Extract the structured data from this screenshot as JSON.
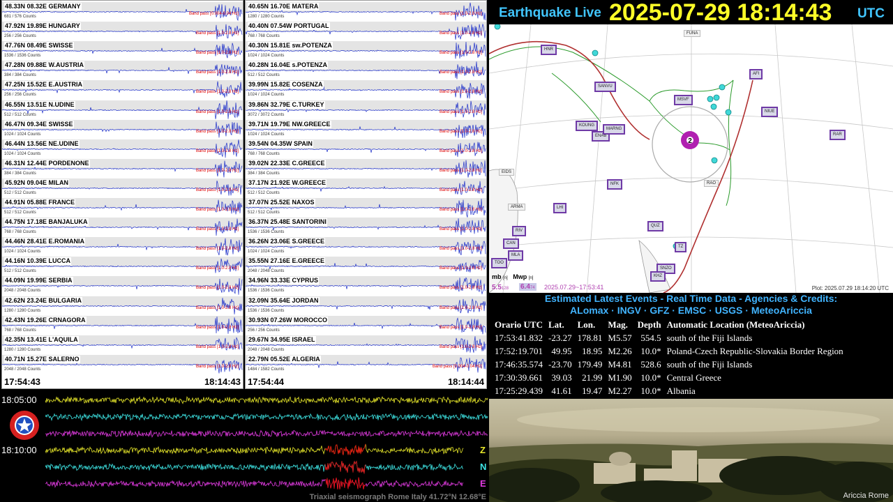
{
  "header": {
    "title": "Earthquake Live",
    "clock": "2025-07-29 18:14:43",
    "tz": "UTC"
  },
  "panels": [
    {
      "start_time": "17:54:43",
      "end_time": "18:14:43",
      "stations": [
        {
          "label": "48.33N 08.32E GERMANY",
          "counts": "681 / 576 Counts",
          "band": "Band pass [0.004-0.04 Hz]"
        },
        {
          "label": "47.92N 19.89E HUNGARY",
          "counts": "256 / 256 Counts",
          "band": "Band pass [1.0-2.8 Hz]"
        },
        {
          "label": "47.76N 08.49E SWISSE",
          "counts": "1536 / 1536 Counts",
          "band": "Band pass [1.0-2.8 Hz]"
        },
        {
          "label": "47.28N 09.88E W.AUSTRIA",
          "counts": "384 / 384 Counts",
          "band": "Band pass [1.0-2.8 Hz]"
        },
        {
          "label": "47.25N 15.52E E.AUSTRIA",
          "counts": "256 / 256 Counts",
          "band": "Band pass [1.0-2.8 Hz]"
        },
        {
          "label": "46.55N 13.51E N.UDINE",
          "counts": "512 / 512 Counts",
          "band": "Band pass [1.0-2.8 Hz]"
        },
        {
          "label": "46.47N 09.34E SWISSE",
          "counts": "1024 / 1024 Counts",
          "band": "Band pass [1.0-2.8 Hz]"
        },
        {
          "label": "46.44N 13.56E NE.UDINE",
          "counts": "1024 / 1024 Counts",
          "band": "Band pass [1.0-2.8 Hz]"
        },
        {
          "label": "46.31N 12.44E PORDENONE",
          "counts": "384 / 384 Counts",
          "band": "Band pass [1.0-2.8 Hz]"
        },
        {
          "label": "45.92N 09.04E MILAN",
          "counts": "512 / 512 Counts",
          "band": "Band pass [1.0-2.8 Hz]"
        },
        {
          "label": "44.91N 05.88E FRANCE",
          "counts": "512 / 512 Counts",
          "band": "Band pass [1.0-2.8 Hz]"
        },
        {
          "label": "44.75N 17.18E BANJALUKA",
          "counts": "768 / 768 Counts",
          "band": "Band pass [1.0-2.8 Hz]"
        },
        {
          "label": "44.46N 28.41E E.ROMANIA",
          "counts": "1024 / 1024 Counts",
          "band": "Band pass [1.0-2.8 Hz]"
        },
        {
          "label": "44.16N 10.39E LUCCA",
          "counts": "512 / 512 Counts",
          "band": "Band pass [1.0-2.8 Hz]"
        },
        {
          "label": "44.09N 19.99E SERBIA",
          "counts": "2048 / 2048 Counts",
          "band": "Band pass [1.0-2.8 Hz]"
        },
        {
          "label": "42.62N 23.24E BULGARIA",
          "counts": "1280 / 1280 Counts",
          "band": "Band pass [1.0-2.8 Hz]"
        },
        {
          "label": "42.43N 19.26E CRNAGORA",
          "counts": "768 / 768 Counts",
          "band": "Band pass [1.0-2.8 Hz]"
        },
        {
          "label": "42.35N 13.41E L'AQUILA",
          "counts": "1280 / 1280 Counts",
          "band": "Band pass [1.0-2.8 Hz]"
        },
        {
          "label": "40.71N 15.27E SALERNO",
          "counts": "2048 / 2048 Counts",
          "band": "Band pass [1.0-2.8 Hz]"
        }
      ]
    },
    {
      "start_time": "17:54:44",
      "end_time": "18:14:44",
      "stations": [
        {
          "label": "40.65N 16.70E MATERA",
          "counts": "1280 / 1280 Counts",
          "band": "Band pass [1.0-2.8 Hz]"
        },
        {
          "label": "40.40N 07.54W PORTUGAL",
          "counts": "768 / 768 Counts",
          "band": "Band pass [1.0-2.8 Hz]"
        },
        {
          "label": "40.30N 15.81E sw.POTENZA",
          "counts": "1024 / 1024 Counts",
          "band": "Band pass [1.0-2.8 Hz]"
        },
        {
          "label": "40.28N 16.04E s.POTENZA",
          "counts": "512 / 512 Counts",
          "band": "Band pass [1.0-2.8 Hz]"
        },
        {
          "label": "39.99N 15.82E COSENZA",
          "counts": "1024 / 1024 Counts",
          "band": "Band pass [1.0-2.8 Hz]"
        },
        {
          "label": "39.86N 32.79E C.TURKEY",
          "counts": "3072 / 3072 Counts",
          "band": "Band pass [1.0-2.8 Hz]"
        },
        {
          "label": "39.71N 19.79E NW.GREECE",
          "counts": "1024 / 1024 Counts",
          "band": "Band pass [1.0-2.8 Hz]"
        },
        {
          "label": "39.54N 04.35W SPAIN",
          "counts": "768 / 768 Counts",
          "band": "Band pass [1.0-2.8 Hz]"
        },
        {
          "label": "39.02N 22.33E C.GREECE",
          "counts": "384 / 384 Counts",
          "band": "Band pass [1.0-2.8 Hz]"
        },
        {
          "label": "37.17N 21.92E W.GREECE",
          "counts": "512 / 512 Counts",
          "band": "Band pass [1.0-2.8 Hz]"
        },
        {
          "label": "37.07N 25.52E NAXOS",
          "counts": "512 / 512 Counts",
          "band": "Band pass [1.0-2.8 Hz]"
        },
        {
          "label": "36.37N 25.48E SANTORINI",
          "counts": "1536 / 1536 Counts",
          "band": "Band pass [1.0-2.8 Hz]"
        },
        {
          "label": "36.26N 23.06E S.GREECE",
          "counts": "1024 / 1024 Counts",
          "band": "Band pass [1.0-2.8 Hz]"
        },
        {
          "label": "35.55N 27.16E E.GREECE",
          "counts": "2048 / 2048 Counts",
          "band": "Band pass [1.0-2.8 Hz]"
        },
        {
          "label": "34.96N 33.33E CYPRUS",
          "counts": "1536 / 1536 Counts",
          "band": "Band pass [1.0-2.8 Hz]"
        },
        {
          "label": "32.09N 35.64E JORDAN",
          "counts": "1536 / 1536 Counts",
          "band": "Band pass [1.0-2.8 Hz]"
        },
        {
          "label": "30.93N 07.26W MOROCCO",
          "counts": "256 / 256 Counts",
          "band": "Band pass [1.0-2.8 Hz]"
        },
        {
          "label": "29.67N 34.95E ISRAEL",
          "counts": "2048 / 2048 Counts",
          "band": "Band pass [1.0-2.8 Hz]"
        },
        {
          "label": "22.79N 05.52E ALGERIA",
          "counts": "1484 / 1582 Counts",
          "band": "Band pass [0.004-0.04 Hz]"
        }
      ]
    }
  ],
  "map": {
    "stations": [
      "HNR",
      "SANVU",
      "MSVF",
      "KOUNG",
      "ENAB",
      "MARNG",
      "AFI",
      "NIUE",
      "RAR",
      "NFK",
      "LHI",
      "QUZ",
      "RIV",
      "CAN",
      "MLA",
      "TOO",
      "SNZO",
      "KHZ",
      "TZ"
    ],
    "places": [
      "FUNA",
      "EIDS",
      "ARMA",
      "RAO"
    ],
    "event_marker": "2",
    "mag_label_mb": "mb",
    "mag_label_mb_n": "[n]",
    "mag_label_mwp": "Mwp",
    "mag_label_mwp_n": "[n]",
    "mb_value": "5.5",
    "mb_count": "128",
    "mwp_value": "6.4",
    "mwp_count": "74",
    "event_time": "2025.07.29~17:53:41",
    "plot_time": "Plot: 2025.07.29 18:14:20 UTC"
  },
  "credits": {
    "line1": "Estimated Latest Events - Real Time Data - Agencies & Credits:",
    "line2": "ALomax · INGV · GFZ · EMSC · USGS · MeteoAriccia"
  },
  "events": {
    "headers": [
      "Orario UTC",
      "Lat.",
      "Lon.",
      "Mag.",
      "Depth",
      "Automatic Location (MeteoAriccia)"
    ],
    "rows": [
      [
        "17:53:41.832",
        "-23.27",
        "178.81",
        "M5.57",
        "554.5",
        "south of the Fiji Islands"
      ],
      [
        "17:52:19.701",
        "49.95",
        "18.95",
        "M2.26",
        "10.0*",
        "Poland-Czech Republic-Slovakia Border Region"
      ],
      [
        "17:46:35.574",
        "-23.70",
        "179.49",
        "M4.81",
        "528.6",
        "south of the Fiji Islands"
      ],
      [
        "17:30:39.661",
        "39.03",
        "21.99",
        "M1.90",
        "10.0*",
        "Central Greece"
      ],
      [
        "17:25:29.439",
        "41.61",
        "19.47",
        "M2.27",
        "10.0*",
        "Albania"
      ]
    ]
  },
  "photo": {
    "caption": "Ariccia  Rome"
  },
  "triaxial": {
    "time_top": "18:05:00",
    "time_mid": "18:10:00",
    "axis_z": "Z",
    "axis_n": "N",
    "axis_e": "E",
    "caption": "Triaxial seismograph Rome Italy 41.72°N 12.68°E",
    "colors": {
      "z": "#e8e82a",
      "n": "#3ee6e6",
      "e": "#e03ae0",
      "event": "#e01010"
    }
  }
}
